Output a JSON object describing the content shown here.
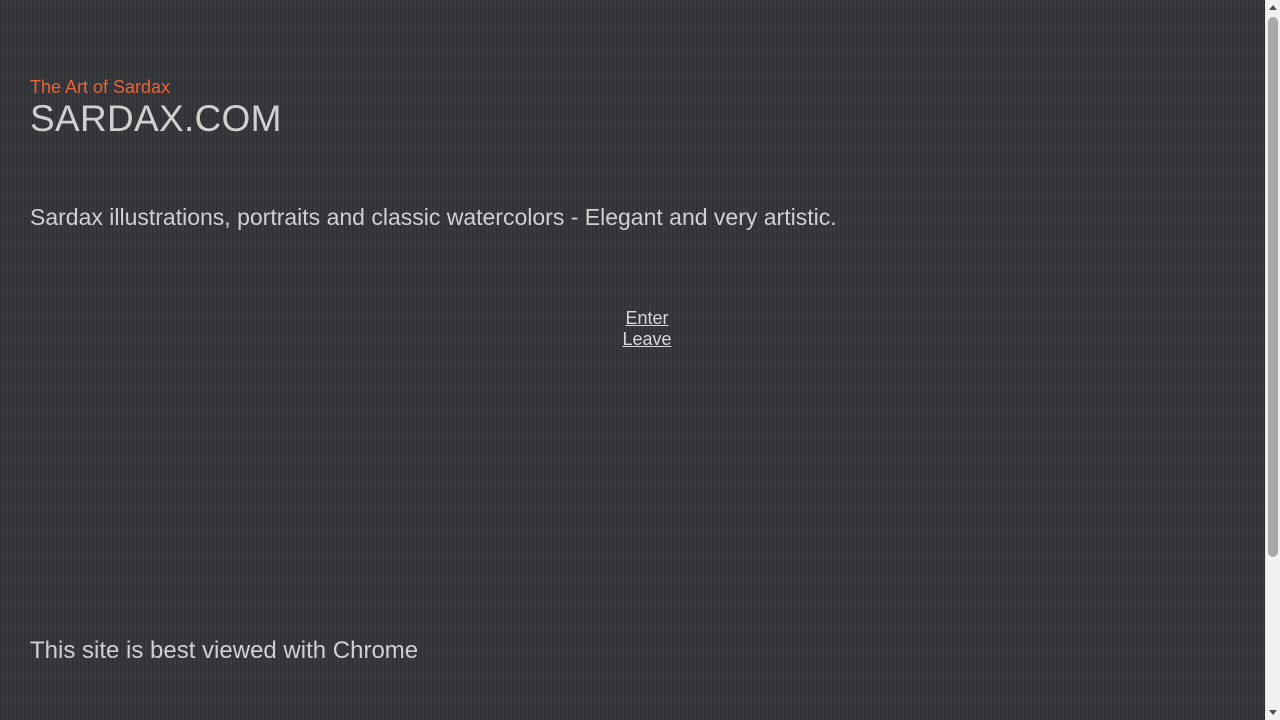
{
  "header": {
    "tagline": "The Art of Sardax",
    "site_title": "SARDAX.COM"
  },
  "main": {
    "description": "Sardax illustrations, portraits and classic watercolors - Elegant and very artistic.",
    "links": {
      "enter_label": "Enter",
      "leave_label": "Leave"
    }
  },
  "footer": {
    "note": "This site is best viewed with Chrome"
  },
  "colors": {
    "background": "#34363a",
    "tagline": "#e8643a",
    "text": "#d0d0d0"
  },
  "icons": {
    "scroll_up": "scroll-up-arrow-icon",
    "scroll_down": "scroll-down-arrow-icon"
  }
}
